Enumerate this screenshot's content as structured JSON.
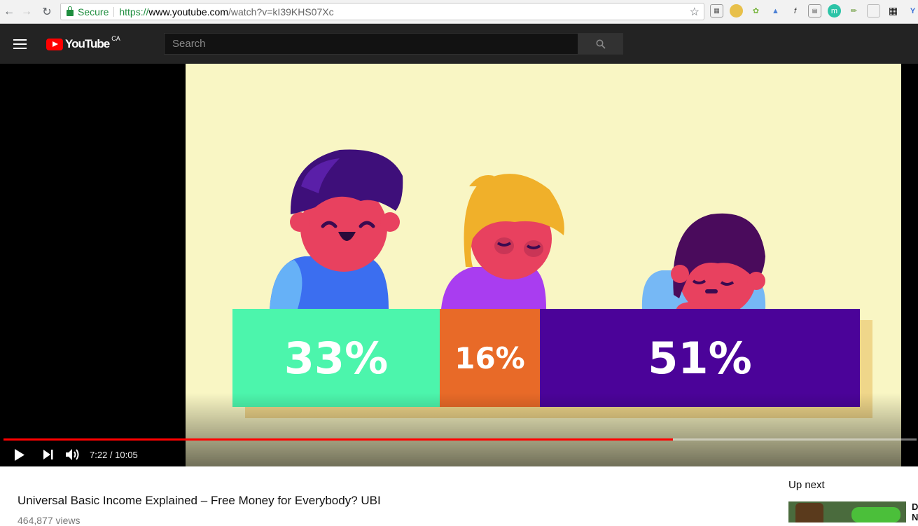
{
  "browser": {
    "secure_label": "Secure",
    "url_scheme": "https://",
    "url_host": "www.youtube.com",
    "url_path": "/watch?v=kI39KHS07Xc"
  },
  "youtube": {
    "logo_text": "YouTube",
    "region": "CA",
    "search_placeholder": "Search"
  },
  "video": {
    "bars": [
      {
        "label": "33%",
        "value": 33,
        "color": "#4cf5ac"
      },
      {
        "label": "16%",
        "value": 16,
        "color": "#e86a28"
      },
      {
        "label": "51%",
        "value": 51,
        "color": "#4b0399"
      }
    ],
    "time_display": "7:22 / 10:05",
    "progress_fraction": 0.733
  },
  "page": {
    "title": "Universal Basic Income Explained – Free Money for Everybody? UBI",
    "views": "464,877 views",
    "up_next_label": "Up next",
    "next_title": "D N"
  }
}
